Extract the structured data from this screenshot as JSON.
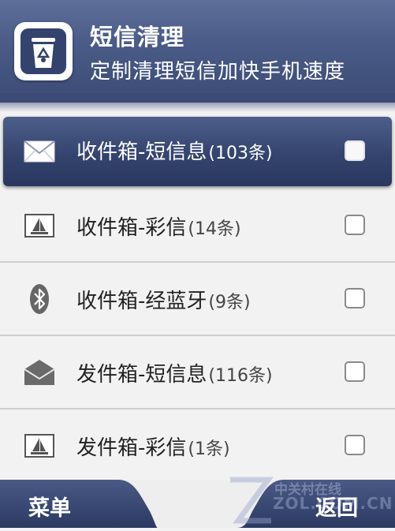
{
  "header": {
    "title": "短信清理",
    "subtitle": "定制清理短信加快手机速度",
    "app_icon": "recycle-bin-icon"
  },
  "rows": [
    {
      "icon": "envelope-icon",
      "label": "收件箱-短信息",
      "count": "(103条)",
      "selected": true,
      "checked": false
    },
    {
      "icon": "mms-picture-icon",
      "label": "收件箱-彩信",
      "count": "(14条)",
      "selected": false,
      "checked": false
    },
    {
      "icon": "bluetooth-icon",
      "label": "收件箱-经蓝牙",
      "count": "(9条)",
      "selected": false,
      "checked": false
    },
    {
      "icon": "envelope-icon",
      "label": "发件箱-短信息",
      "count": "(116条)",
      "selected": false,
      "checked": false
    },
    {
      "icon": "mms-picture-icon",
      "label": "发件箱-彩信",
      "count": "(1条)",
      "selected": false,
      "checked": false
    }
  ],
  "softkeys": {
    "left": "菜单",
    "right": "返回"
  },
  "watermark": {
    "line1": "中关村在线",
    "line2": "ZOL.COM.CN"
  },
  "colors": {
    "header": "#4b5c88",
    "selected_row": "#34446e",
    "softkey": "#32426c"
  }
}
